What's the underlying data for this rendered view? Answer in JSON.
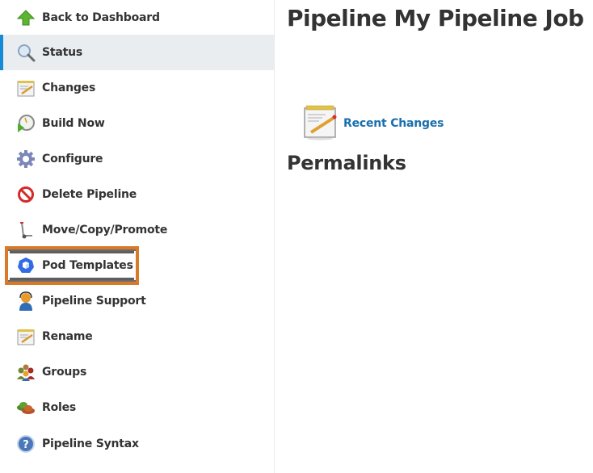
{
  "sidebar": {
    "active_item": "Status",
    "highlighted_item": "Pod Templates",
    "items": [
      {
        "label": "Back to Dashboard",
        "icon": "up-arrow-icon"
      },
      {
        "label": "Status",
        "icon": "magnifier-icon"
      },
      {
        "label": "Changes",
        "icon": "notepad-icon"
      },
      {
        "label": "Build Now",
        "icon": "clock-play-icon"
      },
      {
        "label": "Configure",
        "icon": "gear-icon"
      },
      {
        "label": "Delete Pipeline",
        "icon": "no-entry-icon"
      },
      {
        "label": "Move/Copy/Promote",
        "icon": "hand-truck-icon"
      },
      {
        "label": "Pod Templates",
        "icon": "kubernetes-icon"
      },
      {
        "label": "Pipeline Support",
        "icon": "support-agent-icon"
      },
      {
        "label": "Rename",
        "icon": "notepad-icon"
      },
      {
        "label": "Groups",
        "icon": "group-icon"
      },
      {
        "label": "Roles",
        "icon": "hats-icon"
      },
      {
        "label": "Pipeline Syntax",
        "icon": "help-icon"
      }
    ]
  },
  "main": {
    "title": "Pipeline My Pipeline Job",
    "recent_changes_label": "Recent Changes",
    "permalinks_heading": "Permalinks"
  },
  "colors": {
    "active_accent": "#138bd6",
    "active_background": "#e9edf0",
    "highlight_border": "#d87a2a",
    "link": "#1a6fad",
    "text": "#333333"
  }
}
